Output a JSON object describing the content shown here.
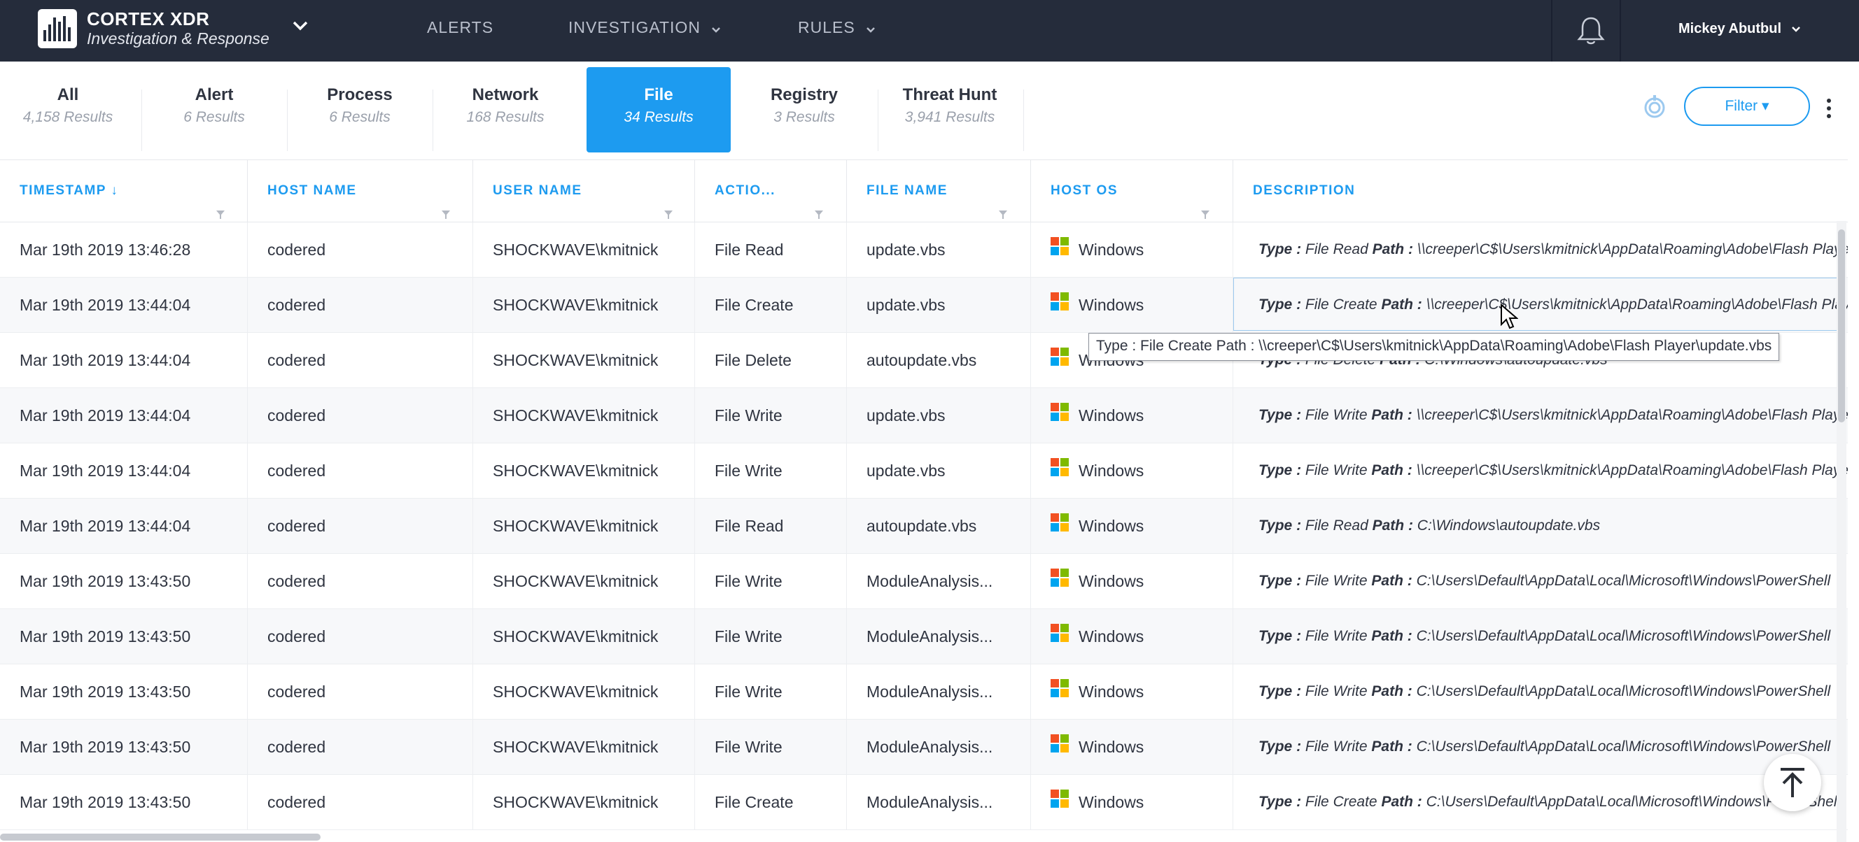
{
  "brand": {
    "title": "CORTEX XDR",
    "subtitle": "Investigation & Response"
  },
  "nav": {
    "alerts": "ALERTS",
    "investigation": "INVESTIGATION",
    "rules": "RULES"
  },
  "user": {
    "name": "Mickey Abutbul"
  },
  "tabs": [
    {
      "label": "All",
      "count": "4,158 Results"
    },
    {
      "label": "Alert",
      "count": "6 Results"
    },
    {
      "label": "Process",
      "count": "6 Results"
    },
    {
      "label": "Network",
      "count": "168 Results"
    },
    {
      "label": "File",
      "count": "34 Results",
      "active": true
    },
    {
      "label": "Registry",
      "count": "3 Results"
    },
    {
      "label": "Threat Hunt",
      "count": "3,941 Results"
    }
  ],
  "filter_label": "Filter ▾",
  "columns": [
    "TIMESTAMP ↓",
    "HOST NAME",
    "USER NAME",
    "ACTIO...",
    "FILE NAME",
    "HOST OS",
    "DESCRIPTION"
  ],
  "rows": [
    {
      "timestamp": "Mar 19th 2019 13:46:28",
      "host": "codered",
      "user": "SHOCKWAVE\\kmitnick",
      "action": "File Read",
      "file": "update.vbs",
      "os": "Windows",
      "type_label": "Type :",
      "type_value": " File Read ",
      "path_label": "Path :",
      "path_value": " \\\\creeper\\C$\\Users\\kmitnick\\AppData\\Roaming\\Adobe\\Flash Player\\update.vbs"
    },
    {
      "timestamp": "Mar 19th 2019 13:44:04",
      "host": "codered",
      "user": "SHOCKWAVE\\kmitnick",
      "action": "File Create",
      "file": "update.vbs",
      "os": "Windows",
      "type_label": "Type :",
      "type_value": " File Create ",
      "path_label": "Path :",
      "path_value": " \\\\creeper\\C$\\Users\\kmitnick\\AppData\\Roaming\\Adobe\\Flash Player\\update.vbs"
    },
    {
      "timestamp": "Mar 19th 2019 13:44:04",
      "host": "codered",
      "user": "SHOCKWAVE\\kmitnick",
      "action": "File Delete",
      "file": "autoupdate.vbs",
      "os": "Windows",
      "type_label": "Type :",
      "type_value": " File Delete ",
      "path_label": "Path :",
      "path_value": " C:\\Windows\\autoupdate.vbs"
    },
    {
      "timestamp": "Mar 19th 2019 13:44:04",
      "host": "codered",
      "user": "SHOCKWAVE\\kmitnick",
      "action": "File Write",
      "file": "update.vbs",
      "os": "Windows",
      "type_label": "Type :",
      "type_value": " File Write ",
      "path_label": "Path :",
      "path_value": " \\\\creeper\\C$\\Users\\kmitnick\\AppData\\Roaming\\Adobe\\Flash Player\\update.vbs"
    },
    {
      "timestamp": "Mar 19th 2019 13:44:04",
      "host": "codered",
      "user": "SHOCKWAVE\\kmitnick",
      "action": "File Write",
      "file": "update.vbs",
      "os": "Windows",
      "type_label": "Type :",
      "type_value": " File Write ",
      "path_label": "Path :",
      "path_value": " \\\\creeper\\C$\\Users\\kmitnick\\AppData\\Roaming\\Adobe\\Flash Player\\update.vbs"
    },
    {
      "timestamp": "Mar 19th 2019 13:44:04",
      "host": "codered",
      "user": "SHOCKWAVE\\kmitnick",
      "action": "File Read",
      "file": "autoupdate.vbs",
      "os": "Windows",
      "type_label": "Type :",
      "type_value": " File Read ",
      "path_label": "Path :",
      "path_value": " C:\\Windows\\autoupdate.vbs"
    },
    {
      "timestamp": "Mar 19th 2019 13:43:50",
      "host": "codered",
      "user": "SHOCKWAVE\\kmitnick",
      "action": "File Write",
      "file": "ModuleAnalysis...",
      "os": "Windows",
      "type_label": "Type :",
      "type_value": " File Write ",
      "path_label": "Path :",
      "path_value": " C:\\Users\\Default\\AppData\\Local\\Microsoft\\Windows\\PowerShell"
    },
    {
      "timestamp": "Mar 19th 2019 13:43:50",
      "host": "codered",
      "user": "SHOCKWAVE\\kmitnick",
      "action": "File Write",
      "file": "ModuleAnalysis...",
      "os": "Windows",
      "type_label": "Type :",
      "type_value": " File Write ",
      "path_label": "Path :",
      "path_value": " C:\\Users\\Default\\AppData\\Local\\Microsoft\\Windows\\PowerShell"
    },
    {
      "timestamp": "Mar 19th 2019 13:43:50",
      "host": "codered",
      "user": "SHOCKWAVE\\kmitnick",
      "action": "File Write",
      "file": "ModuleAnalysis...",
      "os": "Windows",
      "type_label": "Type :",
      "type_value": " File Write ",
      "path_label": "Path :",
      "path_value": " C:\\Users\\Default\\AppData\\Local\\Microsoft\\Windows\\PowerShell"
    },
    {
      "timestamp": "Mar 19th 2019 13:43:50",
      "host": "codered",
      "user": "SHOCKWAVE\\kmitnick",
      "action": "File Write",
      "file": "ModuleAnalysis...",
      "os": "Windows",
      "type_label": "Type :",
      "type_value": " File Write ",
      "path_label": "Path :",
      "path_value": " C:\\Users\\Default\\AppData\\Local\\Microsoft\\Windows\\PowerShell"
    },
    {
      "timestamp": "Mar 19th 2019 13:43:50",
      "host": "codered",
      "user": "SHOCKWAVE\\kmitnick",
      "action": "File Create",
      "file": "ModuleAnalysis...",
      "os": "Windows",
      "type_label": "Type :",
      "type_value": " File Create ",
      "path_label": "Path :",
      "path_value": " C:\\Users\\Default\\AppData\\Local\\Microsoft\\Windows\\PowerShell"
    }
  ],
  "tooltip": "Type : File Create Path : \\\\creeper\\C$\\Users\\kmitnick\\AppData\\Roaming\\Adobe\\Flash Player\\update.vbs",
  "colors": {
    "nav_bg": "#252c3b",
    "accent": "#1d9bf0"
  }
}
